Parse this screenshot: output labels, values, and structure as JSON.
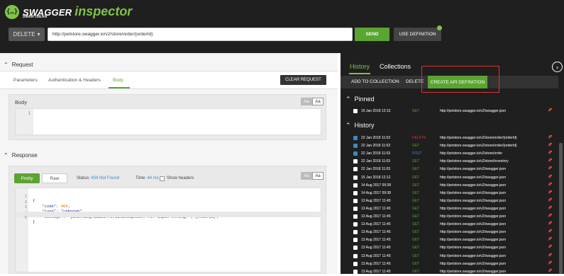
{
  "app": {
    "brand": "SWAGGER",
    "product": "inspector",
    "vendor": "SMARTBEAR",
    "logo_glyph": "{…}",
    "accent_color": "#7ec448"
  },
  "toolbar": {
    "method": "DELETE",
    "url": "http://petstore.swagger.io/v2/store/order/{orderId}",
    "send_label": "SEND",
    "use_definition_label": "USE DEFINITION"
  },
  "request": {
    "title": "Request",
    "tabs": [
      "Parameters",
      "Authentication & Headers",
      "Body"
    ],
    "active_tab": "Body",
    "clear_label": "CLEAR REQUEST",
    "body_label": "Body",
    "font_toggle": [
      "Aa",
      "Aa"
    ],
    "editor_line_number": "1"
  },
  "response": {
    "title": "Response",
    "pretty_label": "Pretty",
    "raw_label": "Raw",
    "status_label": "Status:",
    "status_value": "404 Not Found",
    "time_label": "Time:",
    "time_value": "44 ms",
    "show_headers_label": "Show headers",
    "font_toggle": [
      "Aa",
      "Aa"
    ],
    "line_numbers": [
      "1",
      "2",
      "3",
      "4",
      "5"
    ],
    "code": {
      "open": "{",
      "code_key": "\"code\"",
      "code_val": "404",
      "type_key": "\"type\"",
      "type_val": "\"unknown\"",
      "message_key": "\"message\"",
      "message_val": "\"java.lang.NumberFormatException: For input string: \\\"{orderId}\\\"\"",
      "close": "}"
    }
  },
  "side": {
    "tabs": [
      "History",
      "Collections"
    ],
    "active_tab": "History",
    "actions": {
      "add_to_collection": "ADD TO COLLECTION",
      "delete": "DELETE",
      "create_api_definition": "CREATE API DEFINITION"
    },
    "pinned_title": "Pinned",
    "pinned": [
      {
        "date": "15 Jan 2018 12:13",
        "method": "GET",
        "url": "http://petstore.swagger.io/v2/swagger.json",
        "method_color": "#5aa431",
        "pin_color": "#5aa431"
      }
    ],
    "history_title": "History",
    "history": [
      {
        "date": "22 Jan 2018 11:03",
        "method": "DELETE",
        "url": "http://petstore.swagger.io/v2/store/order/{orderId}",
        "checked": true,
        "method_color": "#d33"
      },
      {
        "date": "22 Jan 2018 11:03",
        "method": "GET",
        "url": "http://petstore.swagger.io/v2/store/order/{orderId}",
        "checked": true,
        "method_color": "#5aa431"
      },
      {
        "date": "22 Jan 2018 11:03",
        "method": "POST",
        "url": "http://petstore.swagger.io/v2/store/order",
        "checked": true,
        "method_color": "#3b88c3"
      },
      {
        "date": "22 Jan 2018 11:03",
        "method": "GET",
        "url": "http://petstore.swagger.io/v2/store/inventory",
        "checked": false,
        "method_color": "#5aa431"
      },
      {
        "date": "22 Jan 2018 11:03",
        "method": "GET",
        "url": "http://petstore.swagger.io/v2/swagger.json",
        "checked": false,
        "method_color": "#5aa431"
      },
      {
        "date": "15 Jan 2018 12:12",
        "method": "GET",
        "url": "http://petstore.swagger.io/v2/swagger.json",
        "checked": false,
        "method_color": "#5aa431"
      },
      {
        "date": "14 Aug 2017 09:38",
        "method": "GET",
        "url": "http://petstore.swagger.io/v2/swagger.json",
        "checked": false,
        "method_color": "#5aa431"
      },
      {
        "date": "14 Aug 2017 09:38",
        "method": "GET",
        "url": "http://petstore.swagger.io/v2/swagger.json",
        "checked": false,
        "method_color": "#5aa431"
      },
      {
        "date": "13 Aug 2017 11:45",
        "method": "GET",
        "url": "http://petstore.swagger.io/v2/swagger.json",
        "checked": false,
        "method_color": "#5aa431"
      },
      {
        "date": "13 Aug 2017 11:45",
        "method": "GET",
        "url": "http://petstore.swagger.io/v2/swagger.json",
        "checked": false,
        "method_color": "#5aa431"
      },
      {
        "date": "13 Aug 2017 11:45",
        "method": "GET",
        "url": "http://petstore.swagger.io/v2/swagger.json",
        "checked": false,
        "method_color": "#5aa431"
      },
      {
        "date": "13 Aug 2017 11:45",
        "method": "GET",
        "url": "http://petstore.swagger.io/v2/swagger.json",
        "checked": false,
        "method_color": "#5aa431"
      },
      {
        "date": "13 Aug 2017 11:45",
        "method": "GET",
        "url": "http://petstore.swagger.io/v2/swagger.json",
        "checked": false,
        "method_color": "#5aa431"
      },
      {
        "date": "13 Aug 2017 11:45",
        "method": "GET",
        "url": "http://petstore.swagger.io/v2/swagger.json",
        "checked": false,
        "method_color": "#5aa431"
      },
      {
        "date": "13 Aug 2017 11:45",
        "method": "GET",
        "url": "http://petstore.swagger.io/v2/swagger.json",
        "checked": false,
        "method_color": "#5aa431"
      },
      {
        "date": "13 Aug 2017 11:45",
        "method": "GET",
        "url": "http://petstore.swagger.io/v2/swagger.json",
        "checked": false,
        "method_color": "#5aa431"
      },
      {
        "date": "13 Aug 2017 11:45",
        "method": "GET",
        "url": "http://petstore.swagger.io/v2/swagger.json",
        "checked": false,
        "method_color": "#5aa431"
      },
      {
        "date": "13 Aug 2017 11:45",
        "method": "GET",
        "url": "http://petstore.swagger.io/v2/swagger.json",
        "checked": false,
        "method_color": "#5aa431"
      }
    ]
  }
}
